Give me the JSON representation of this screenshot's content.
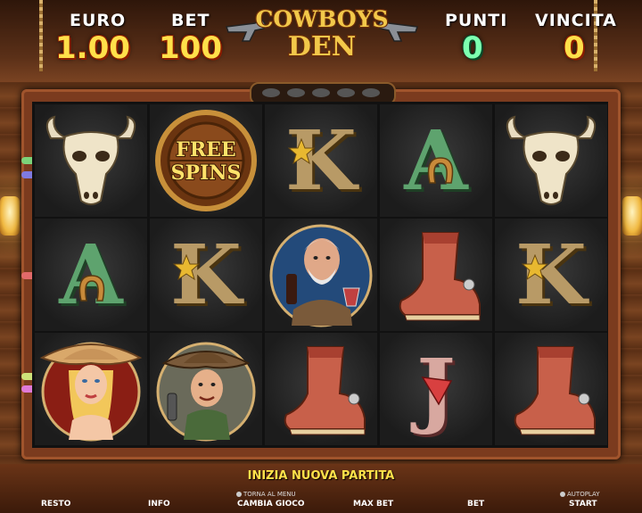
{
  "header": {
    "euro_label": "EURO",
    "euro_value": "1.00",
    "bet_label": "BET",
    "bet_value": "100",
    "punti_label": "PUNTI",
    "punti_value": "0",
    "vincita_label": "VINCITA",
    "vincita_value": "0"
  },
  "logo": {
    "line1": "COWBOYS",
    "line2": "DEN"
  },
  "reels": [
    [
      "bull-skull",
      "letter-a",
      "cowgirl"
    ],
    [
      "free-spins",
      "letter-k",
      "cowboy"
    ],
    [
      "letter-k",
      "old-man",
      "boot"
    ],
    [
      "letter-a",
      "boot",
      "letter-j"
    ],
    [
      "bull-skull",
      "letter-k",
      "boot"
    ]
  ],
  "symbols": {
    "free_spins_line1": "FREE",
    "free_spins_line2": "SPINS",
    "letter_a": "A",
    "letter_k": "K",
    "letter_j": "J"
  },
  "footer": {
    "new_game": "INIZIA NUOVA PARTITA",
    "resto": "RESTO",
    "info": "INFO",
    "torna_al_menu": "TORNA AL MENU",
    "cambia_gioco": "CAMBIA GIOCO",
    "max_bet": "MAX BET",
    "bet": "BET",
    "autoplay": "AUTOPLAY",
    "start": "START"
  },
  "colors": {
    "gold_text": "#ffe04a",
    "green_text": "#7dffb0",
    "frame": "#7b3b1e"
  }
}
